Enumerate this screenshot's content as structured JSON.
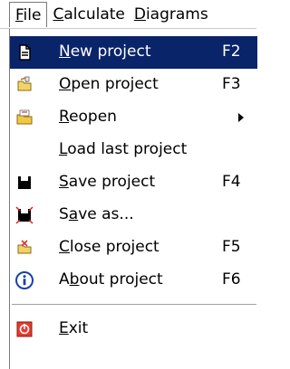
{
  "menubar": {
    "items": [
      {
        "prefix": "",
        "underline": "F",
        "rest": "ile",
        "active": true
      },
      {
        "prefix": "",
        "underline": "C",
        "rest": "alculate",
        "active": false
      },
      {
        "prefix": "",
        "underline": "D",
        "rest": "iagrams",
        "active": false
      }
    ]
  },
  "file_menu": {
    "items": [
      {
        "icon": "document-icon",
        "prefix": "",
        "underline": "N",
        "rest": "ew project",
        "shortcut": "F2",
        "selected": true
      },
      {
        "icon": "open-folder-icon",
        "prefix": "",
        "underline": "O",
        "rest": "pen project",
        "shortcut": "F3",
        "selected": false
      },
      {
        "icon": "reopen-folder-icon",
        "prefix": "",
        "underline": "R",
        "rest": "eopen",
        "shortcut": "",
        "submenu": true
      },
      {
        "icon": "",
        "prefix": "",
        "underline": "L",
        "rest": "oad last project",
        "shortcut": ""
      },
      {
        "icon": "floppy-disk-icon",
        "prefix": "",
        "underline": "S",
        "rest": "ave project",
        "shortcut": "F4"
      },
      {
        "icon": "save-as-icon",
        "prefix": "S",
        "underline": "a",
        "rest": "ve as...",
        "shortcut": ""
      },
      {
        "icon": "close-folder-icon",
        "prefix": "",
        "underline": "C",
        "rest": "lose project",
        "shortcut": "F5"
      },
      {
        "icon": "info-icon",
        "prefix": "A",
        "underline": "b",
        "rest": "out project",
        "shortcut": "F6"
      },
      {
        "icon": "exit-icon",
        "prefix": "",
        "underline": "E",
        "rest": "xit",
        "shortcut": ""
      }
    ]
  },
  "colors": {
    "selection_bg": "#0a246a",
    "selection_fg": "#ffffff"
  }
}
